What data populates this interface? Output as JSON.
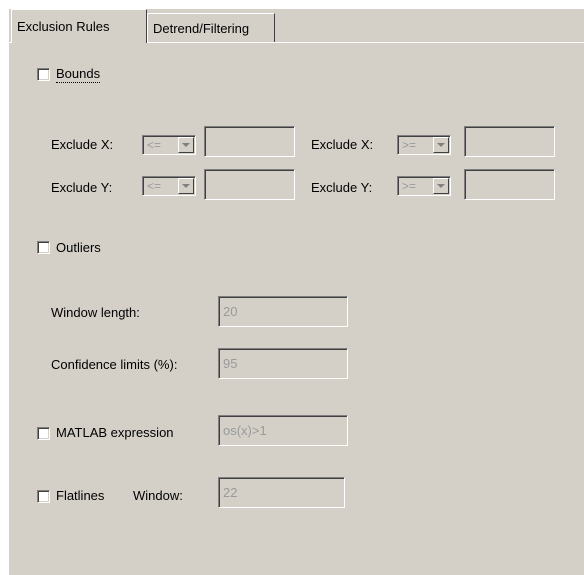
{
  "tabs": [
    {
      "label": "Exclusion Rules",
      "active": true
    },
    {
      "label": "Detrend/Filtering",
      "active": false
    }
  ],
  "bounds": {
    "checkbox_label": "Bounds",
    "checked": false,
    "rows": [
      {
        "left_label": "Exclude X:",
        "left_op": "<=",
        "left_value": "",
        "right_label": "Exclude X:",
        "right_op": ">=",
        "right_value": ""
      },
      {
        "left_label": "Exclude Y:",
        "left_op": "<=",
        "left_value": "",
        "right_label": "Exclude Y:",
        "right_op": ">=",
        "right_value": ""
      }
    ]
  },
  "outliers": {
    "checkbox_label": "Outliers",
    "checked": false,
    "window_length_label": "Window length:",
    "window_length_value": "20",
    "confidence_label": "Confidence limits (%):",
    "confidence_value": "95"
  },
  "matlab": {
    "checkbox_label": "MATLAB expression",
    "checked": false,
    "expression_value": "os(x)>1"
  },
  "flatlines": {
    "checkbox_label": "Flatlines",
    "checked": false,
    "window_label": "Window:",
    "window_value": "22"
  },
  "colors": {
    "panel_bg": "#d4d0c8",
    "disabled_text": "#9a9a9a"
  }
}
